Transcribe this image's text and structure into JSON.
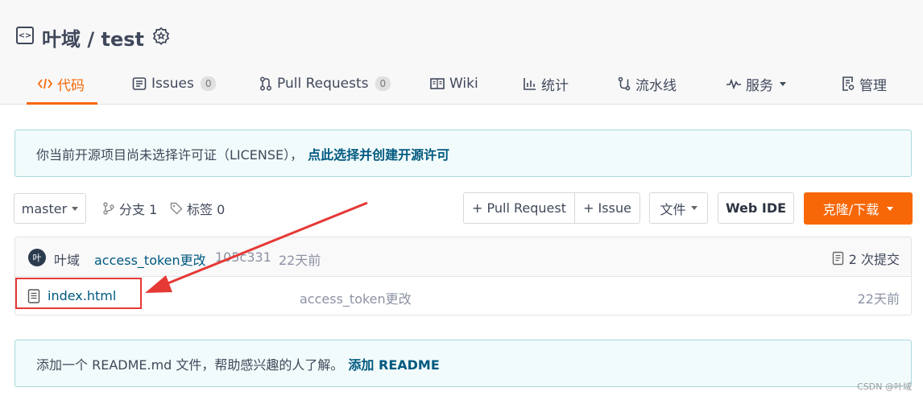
{
  "repo": {
    "title": "叶域 / test"
  },
  "tabs": [
    {
      "label": "代码",
      "active": true,
      "icon": "code-icon"
    },
    {
      "label": "Issues",
      "count": "0",
      "icon": "issues-icon"
    },
    {
      "label": "Pull Requests",
      "count": "0",
      "icon": "pull-request-icon"
    },
    {
      "label": "Wiki",
      "icon": "book-icon"
    },
    {
      "label": "统计",
      "icon": "stats-icon"
    },
    {
      "label": "流水线",
      "icon": "pipeline-icon"
    },
    {
      "label": "服务",
      "icon": "pulse-icon"
    },
    {
      "label": "管理",
      "icon": "settings-doc-icon"
    }
  ],
  "license_alert": {
    "text": "你当前开源项目尚未选择许可证（LICENSE），",
    "link": "点此选择并创建开源许可"
  },
  "toolbar": {
    "branch": "master",
    "branches": "分支 1",
    "tags": "标签 0",
    "pull_request": "+ Pull Request",
    "issue": "+ Issue",
    "file": "文件",
    "web_ide": "Web IDE",
    "clone": "克隆/下载"
  },
  "commit": {
    "avatar_initial": "叶",
    "author": "叶域",
    "message": "access_token更改",
    "hash": "105c331",
    "time": "22天前",
    "commit_count": "2 次提交"
  },
  "files": [
    {
      "name": "index.html",
      "message": "access_token更改",
      "time": "22天前"
    }
  ],
  "readme_alert": {
    "text": "添加一个 README.md 文件，帮助感兴趣的人了解。",
    "link": "添加 README"
  },
  "watermark": "CSDN @叶域",
  "colors": {
    "accent": "#f76707",
    "link": "#005980",
    "annotation": "#e53935"
  }
}
